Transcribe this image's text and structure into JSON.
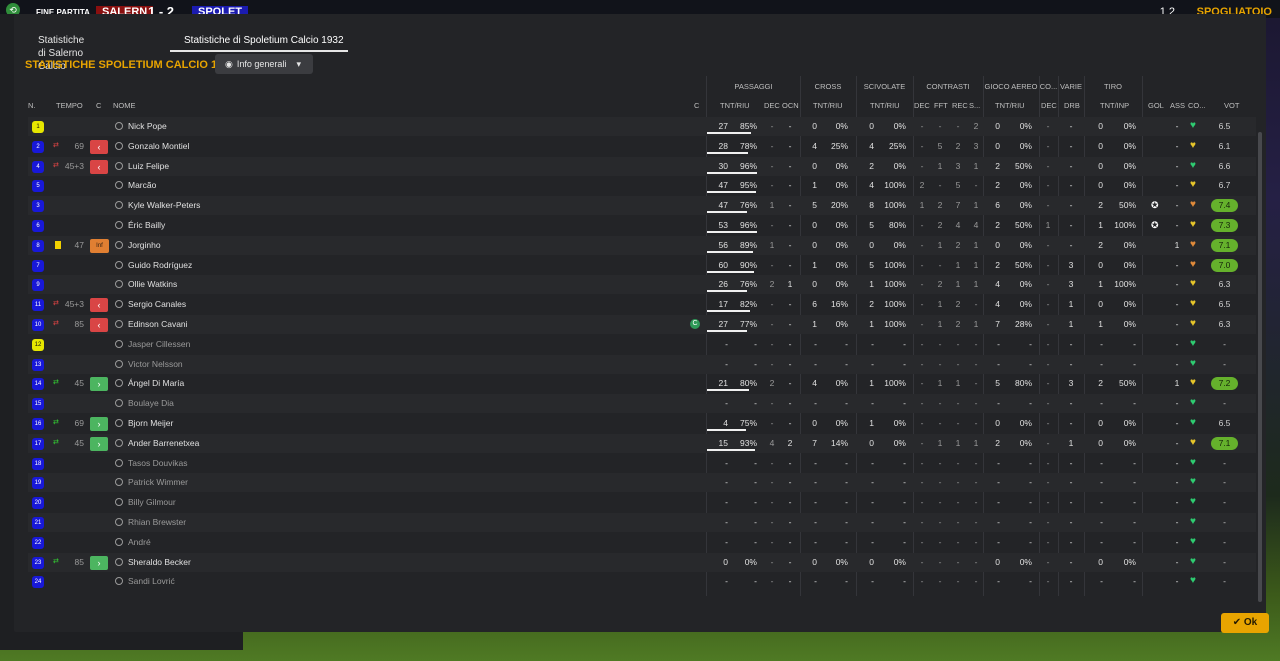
{
  "topbar": {
    "label": "FINE PARTITA",
    "home": "SALERN",
    "score": "1 - 2",
    "away": "SPOLET",
    "right": "SPOGLIATOIO",
    "right2": "1 2"
  },
  "tabs": [
    "Statistiche di Salerno Calcio",
    "Statistiche di Spoletium Calcio 1932"
  ],
  "section_title": "STATISTICHE SPOLETIUM CALCIO 1932",
  "dropdown": "Info generali",
  "headers": {
    "groups": [
      "PASSAGGI",
      "CROSS",
      "SCIVOLATE",
      "CONTRASTI",
      "GIOCO AEREO",
      "CO...",
      "VARIE",
      "TIRO"
    ],
    "cols": [
      "N.",
      "TEMPO",
      "C",
      "NOME",
      "C",
      "TNT/RIU",
      "DEC",
      "OCN",
      "TNT/RIU",
      "TNT/RIU",
      "DEC",
      "FFT",
      "REC",
      "S...",
      "TNT/RIU",
      "DEC",
      "DRB",
      "TNT/INP",
      "GOL",
      "ASS",
      "CO...",
      "VOT"
    ]
  },
  "players": [
    {
      "n": "1",
      "gk": true,
      "tempo": "",
      "sub": "",
      "badge": "",
      "name": "Nick Pope",
      "cap": false,
      "p1": "27",
      "p2": "85%",
      "pbar": 0.85,
      "dec": "-",
      "ocn": "-",
      "c1": "0",
      "c2": "0%",
      "s1": "0",
      "s2": "0%",
      "ct": [
        "-",
        "-",
        "-",
        "2"
      ],
      "a1": "0",
      "a2": "0%",
      "co": "-",
      "drb": "-",
      "t1": "0",
      "t2": "0%",
      "gol": "",
      "ass": "-",
      "heart": "green",
      "vot": "6.5",
      "hi": false
    },
    {
      "n": "2",
      "gk": false,
      "tempo": "69",
      "sub": "out",
      "badge": "out",
      "name": "Gonzalo Montiel",
      "cap": false,
      "p1": "28",
      "p2": "78%",
      "pbar": 0.78,
      "dec": "-",
      "ocn": "-",
      "c1": "4",
      "c2": "25%",
      "s1": "4",
      "s2": "25%",
      "ct": [
        "-",
        "5",
        "2",
        "3"
      ],
      "a1": "0",
      "a2": "0%",
      "co": "-",
      "drb": "-",
      "t1": "0",
      "t2": "0%",
      "gol": "",
      "ass": "-",
      "heart": "yellow",
      "vot": "6.1",
      "hi": false
    },
    {
      "n": "4",
      "gk": false,
      "tempo": "45+3",
      "sub": "out",
      "badge": "out",
      "name": "Luiz Felipe",
      "cap": false,
      "p1": "30",
      "p2": "96%",
      "pbar": 0.96,
      "dec": "-",
      "ocn": "-",
      "c1": "0",
      "c2": "0%",
      "s1": "2",
      "s2": "0%",
      "ct": [
        "-",
        "1",
        "3",
        "1"
      ],
      "a1": "2",
      "a2": "50%",
      "co": "-",
      "drb": "-",
      "t1": "0",
      "t2": "0%",
      "gol": "",
      "ass": "-",
      "heart": "green",
      "vot": "6.6",
      "hi": false
    },
    {
      "n": "5",
      "gk": false,
      "tempo": "",
      "sub": "",
      "badge": "",
      "name": "Marcão",
      "cap": false,
      "p1": "47",
      "p2": "95%",
      "pbar": 0.95,
      "dec": "-",
      "ocn": "-",
      "c1": "1",
      "c2": "0%",
      "s1": "4",
      "s2": "100%",
      "ct": [
        "2",
        "-",
        "5",
        "-"
      ],
      "a1": "2",
      "a2": "0%",
      "co": "-",
      "drb": "-",
      "t1": "0",
      "t2": "0%",
      "gol": "",
      "ass": "-",
      "heart": "yellow",
      "vot": "6.7",
      "hi": false
    },
    {
      "n": "3",
      "gk": false,
      "tempo": "",
      "sub": "",
      "badge": "",
      "name": "Kyle Walker-Peters",
      "cap": false,
      "p1": "47",
      "p2": "76%",
      "pbar": 0.76,
      "dec": "1",
      "ocn": "-",
      "c1": "5",
      "c2": "20%",
      "s1": "8",
      "s2": "100%",
      "ct": [
        "1",
        "2",
        "7",
        "1"
      ],
      "a1": "6",
      "a2": "0%",
      "co": "-",
      "drb": "-",
      "t1": "2",
      "t2": "50%",
      "gol": "ball",
      "ass": "-",
      "heart": "orange",
      "vot": "7.4",
      "hi": true
    },
    {
      "n": "6",
      "gk": false,
      "tempo": "",
      "sub": "",
      "badge": "",
      "name": "Éric Bailly",
      "cap": false,
      "p1": "53",
      "p2": "96%",
      "pbar": 0.96,
      "dec": "-",
      "ocn": "-",
      "c1": "0",
      "c2": "0%",
      "s1": "5",
      "s2": "80%",
      "ct": [
        "-",
        "2",
        "4",
        "4"
      ],
      "a1": "2",
      "a2": "50%",
      "co": "1",
      "drb": "-",
      "t1": "1",
      "t2": "100%",
      "gol": "ball",
      "ass": "-",
      "heart": "yellow",
      "vot": "7.3",
      "hi": true
    },
    {
      "n": "8",
      "gk": false,
      "tempo": "47",
      "sub": "yellow",
      "badge": "inf",
      "name": "Jorginho",
      "cap": false,
      "p1": "56",
      "p2": "89%",
      "pbar": 0.89,
      "dec": "1",
      "ocn": "-",
      "c1": "0",
      "c2": "0%",
      "s1": "0",
      "s2": "0%",
      "ct": [
        "-",
        "1",
        "2",
        "1"
      ],
      "a1": "0",
      "a2": "0%",
      "co": "-",
      "drb": "-",
      "t1": "2",
      "t2": "0%",
      "gol": "",
      "ass": "1",
      "heart": "orange",
      "vot": "7.1",
      "hi": true
    },
    {
      "n": "7",
      "gk": false,
      "tempo": "",
      "sub": "",
      "badge": "",
      "name": "Guido Rodríguez",
      "cap": false,
      "p1": "60",
      "p2": "90%",
      "pbar": 0.9,
      "dec": "-",
      "ocn": "-",
      "c1": "1",
      "c2": "0%",
      "s1": "5",
      "s2": "100%",
      "ct": [
        "-",
        "-",
        "1",
        "1"
      ],
      "a1": "2",
      "a2": "50%",
      "co": "-",
      "drb": "3",
      "t1": "0",
      "t2": "0%",
      "gol": "",
      "ass": "-",
      "heart": "orange",
      "vot": "7.0",
      "hi": true
    },
    {
      "n": "9",
      "gk": false,
      "tempo": "",
      "sub": "",
      "badge": "",
      "name": "Ollie Watkins",
      "cap": false,
      "p1": "26",
      "p2": "76%",
      "pbar": 0.76,
      "dec": "2",
      "ocn": "1",
      "c1": "0",
      "c2": "0%",
      "s1": "1",
      "s2": "100%",
      "ct": [
        "-",
        "2",
        "1",
        "1"
      ],
      "a1": "4",
      "a2": "0%",
      "co": "-",
      "drb": "3",
      "t1": "1",
      "t2": "100%",
      "gol": "",
      "ass": "-",
      "heart": "yellow",
      "vot": "6.3",
      "hi": false
    },
    {
      "n": "11",
      "gk": false,
      "tempo": "45+3",
      "sub": "out",
      "badge": "out",
      "name": "Sergio Canales",
      "cap": false,
      "p1": "17",
      "p2": "82%",
      "pbar": 0.82,
      "dec": "-",
      "ocn": "-",
      "c1": "6",
      "c2": "16%",
      "s1": "2",
      "s2": "100%",
      "ct": [
        "-",
        "1",
        "2",
        "-"
      ],
      "a1": "4",
      "a2": "0%",
      "co": "-",
      "drb": "1",
      "t1": "0",
      "t2": "0%",
      "gol": "",
      "ass": "-",
      "heart": "yellow",
      "vot": "6.5",
      "hi": false
    },
    {
      "n": "10",
      "gk": false,
      "tempo": "85",
      "sub": "out",
      "badge": "out",
      "name": "Edinson Cavani",
      "cap": true,
      "p1": "27",
      "p2": "77%",
      "pbar": 0.77,
      "dec": "-",
      "ocn": "-",
      "c1": "1",
      "c2": "0%",
      "s1": "1",
      "s2": "100%",
      "ct": [
        "-",
        "1",
        "2",
        "1"
      ],
      "a1": "7",
      "a2": "28%",
      "co": "-",
      "drb": "1",
      "t1": "1",
      "t2": "0%",
      "gol": "",
      "ass": "-",
      "heart": "yellow",
      "vot": "6.3",
      "hi": false
    },
    {
      "n": "12",
      "gk": true,
      "tempo": "",
      "sub": "",
      "badge": "",
      "name": "Jasper Cillessen",
      "cap": false,
      "p1": "-",
      "p2": "-",
      "pbar": 0,
      "dec": "-",
      "ocn": "-",
      "c1": "-",
      "c2": "-",
      "s1": "-",
      "s2": "-",
      "ct": [
        "-",
        "-",
        "-",
        "-"
      ],
      "a1": "-",
      "a2": "-",
      "co": "-",
      "drb": "-",
      "t1": "-",
      "t2": "-",
      "gol": "",
      "ass": "-",
      "heart": "green",
      "vot": "-",
      "hi": false
    },
    {
      "n": "13",
      "gk": false,
      "tempo": "",
      "sub": "",
      "badge": "",
      "name": "Victor Nelsson",
      "cap": false,
      "p1": "-",
      "p2": "-",
      "pbar": 0,
      "dec": "-",
      "ocn": "-",
      "c1": "-",
      "c2": "-",
      "s1": "-",
      "s2": "-",
      "ct": [
        "-",
        "-",
        "-",
        "-"
      ],
      "a1": "-",
      "a2": "-",
      "co": "-",
      "drb": "-",
      "t1": "-",
      "t2": "-",
      "gol": "",
      "ass": "-",
      "heart": "green",
      "vot": "-",
      "hi": false
    },
    {
      "n": "14",
      "gk": false,
      "tempo": "45",
      "sub": "in",
      "badge": "in",
      "name": "Ángel Di María",
      "cap": false,
      "p1": "21",
      "p2": "80%",
      "pbar": 0.8,
      "dec": "2",
      "ocn": "-",
      "c1": "4",
      "c2": "0%",
      "s1": "1",
      "s2": "100%",
      "ct": [
        "-",
        "1",
        "1",
        "-"
      ],
      "a1": "5",
      "a2": "80%",
      "co": "-",
      "drb": "3",
      "t1": "2",
      "t2": "50%",
      "gol": "",
      "ass": "1",
      "heart": "yellow",
      "vot": "7.2",
      "hi": true
    },
    {
      "n": "15",
      "gk": false,
      "tempo": "",
      "sub": "",
      "badge": "",
      "name": "Boulaye Dia",
      "cap": false,
      "p1": "-",
      "p2": "-",
      "pbar": 0,
      "dec": "-",
      "ocn": "-",
      "c1": "-",
      "c2": "-",
      "s1": "-",
      "s2": "-",
      "ct": [
        "-",
        "-",
        "-",
        "-"
      ],
      "a1": "-",
      "a2": "-",
      "co": "-",
      "drb": "-",
      "t1": "-",
      "t2": "-",
      "gol": "",
      "ass": "-",
      "heart": "green",
      "vot": "-",
      "hi": false
    },
    {
      "n": "16",
      "gk": false,
      "tempo": "69",
      "sub": "in",
      "badge": "in",
      "name": "Bjorn Meijer",
      "cap": false,
      "p1": "4",
      "p2": "75%",
      "pbar": 0.75,
      "dec": "-",
      "ocn": "-",
      "c1": "0",
      "c2": "0%",
      "s1": "1",
      "s2": "0%",
      "ct": [
        "-",
        "-",
        "-",
        "-"
      ],
      "a1": "0",
      "a2": "0%",
      "co": "-",
      "drb": "-",
      "t1": "0",
      "t2": "0%",
      "gol": "",
      "ass": "-",
      "heart": "green",
      "vot": "6.5",
      "hi": false
    },
    {
      "n": "17",
      "gk": false,
      "tempo": "45",
      "sub": "in",
      "badge": "in",
      "name": "Ander Barrenetxea",
      "cap": false,
      "p1": "15",
      "p2": "93%",
      "pbar": 0.93,
      "dec": "4",
      "ocn": "2",
      "c1": "7",
      "c2": "14%",
      "s1": "0",
      "s2": "0%",
      "ct": [
        "-",
        "1",
        "1",
        "1"
      ],
      "a1": "2",
      "a2": "0%",
      "co": "-",
      "drb": "1",
      "t1": "0",
      "t2": "0%",
      "gol": "",
      "ass": "-",
      "heart": "yellow",
      "vot": "7.1",
      "hi": true
    },
    {
      "n": "18",
      "gk": false,
      "tempo": "",
      "sub": "",
      "badge": "",
      "name": "Tasos Douvikas",
      "cap": false,
      "p1": "-",
      "p2": "-",
      "pbar": 0,
      "dec": "-",
      "ocn": "-",
      "c1": "-",
      "c2": "-",
      "s1": "-",
      "s2": "-",
      "ct": [
        "-",
        "-",
        "-",
        "-"
      ],
      "a1": "-",
      "a2": "-",
      "co": "-",
      "drb": "-",
      "t1": "-",
      "t2": "-",
      "gol": "",
      "ass": "-",
      "heart": "green",
      "vot": "-",
      "hi": false
    },
    {
      "n": "19",
      "gk": false,
      "tempo": "",
      "sub": "",
      "badge": "",
      "name": "Patrick Wimmer",
      "cap": false,
      "p1": "-",
      "p2": "-",
      "pbar": 0,
      "dec": "-",
      "ocn": "-",
      "c1": "-",
      "c2": "-",
      "s1": "-",
      "s2": "-",
      "ct": [
        "-",
        "-",
        "-",
        "-"
      ],
      "a1": "-",
      "a2": "-",
      "co": "-",
      "drb": "-",
      "t1": "-",
      "t2": "-",
      "gol": "",
      "ass": "-",
      "heart": "green",
      "vot": "-",
      "hi": false
    },
    {
      "n": "20",
      "gk": false,
      "tempo": "",
      "sub": "",
      "badge": "",
      "name": "Billy Gilmour",
      "cap": false,
      "p1": "-",
      "p2": "-",
      "pbar": 0,
      "dec": "-",
      "ocn": "-",
      "c1": "-",
      "c2": "-",
      "s1": "-",
      "s2": "-",
      "ct": [
        "-",
        "-",
        "-",
        "-"
      ],
      "a1": "-",
      "a2": "-",
      "co": "-",
      "drb": "-",
      "t1": "-",
      "t2": "-",
      "gol": "",
      "ass": "-",
      "heart": "green",
      "vot": "-",
      "hi": false
    },
    {
      "n": "21",
      "gk": false,
      "tempo": "",
      "sub": "",
      "badge": "",
      "name": "Rhian Brewster",
      "cap": false,
      "p1": "-",
      "p2": "-",
      "pbar": 0,
      "dec": "-",
      "ocn": "-",
      "c1": "-",
      "c2": "-",
      "s1": "-",
      "s2": "-",
      "ct": [
        "-",
        "-",
        "-",
        "-"
      ],
      "a1": "-",
      "a2": "-",
      "co": "-",
      "drb": "-",
      "t1": "-",
      "t2": "-",
      "gol": "",
      "ass": "-",
      "heart": "green",
      "vot": "-",
      "hi": false
    },
    {
      "n": "22",
      "gk": false,
      "tempo": "",
      "sub": "",
      "badge": "",
      "name": "André",
      "cap": false,
      "p1": "-",
      "p2": "-",
      "pbar": 0,
      "dec": "-",
      "ocn": "-",
      "c1": "-",
      "c2": "-",
      "s1": "-",
      "s2": "-",
      "ct": [
        "-",
        "-",
        "-",
        "-"
      ],
      "a1": "-",
      "a2": "-",
      "co": "-",
      "drb": "-",
      "t1": "-",
      "t2": "-",
      "gol": "",
      "ass": "-",
      "heart": "green",
      "vot": "-",
      "hi": false
    },
    {
      "n": "23",
      "gk": false,
      "tempo": "85",
      "sub": "in",
      "badge": "in",
      "name": "Sheraldo Becker",
      "cap": false,
      "p1": "0",
      "p2": "0%",
      "pbar": 0,
      "dec": "-",
      "ocn": "-",
      "c1": "0",
      "c2": "0%",
      "s1": "0",
      "s2": "0%",
      "ct": [
        "-",
        "-",
        "-",
        "-"
      ],
      "a1": "0",
      "a2": "0%",
      "co": "-",
      "drb": "-",
      "t1": "0",
      "t2": "0%",
      "gol": "",
      "ass": "-",
      "heart": "green",
      "vot": "-",
      "hi": false
    },
    {
      "n": "24",
      "gk": false,
      "tempo": "",
      "sub": "",
      "badge": "",
      "name": "Sandi Lovrić",
      "cap": false,
      "p1": "-",
      "p2": "-",
      "pbar": 0,
      "dec": "-",
      "ocn": "-",
      "c1": "-",
      "c2": "-",
      "s1": "-",
      "s2": "-",
      "ct": [
        "-",
        "-",
        "-",
        "-"
      ],
      "a1": "-",
      "a2": "-",
      "co": "-",
      "drb": "-",
      "t1": "-",
      "t2": "-",
      "gol": "",
      "ass": "-",
      "heart": "green",
      "vot": "-",
      "hi": false
    }
  ],
  "ok_label": "Ok",
  "colors": {
    "accent": "#e8a400",
    "rating_high": "#65b12c",
    "out": "#d94545",
    "in": "#4cb560",
    "shirt": "#1818d8",
    "gk_shirt": "#e6e600"
  }
}
